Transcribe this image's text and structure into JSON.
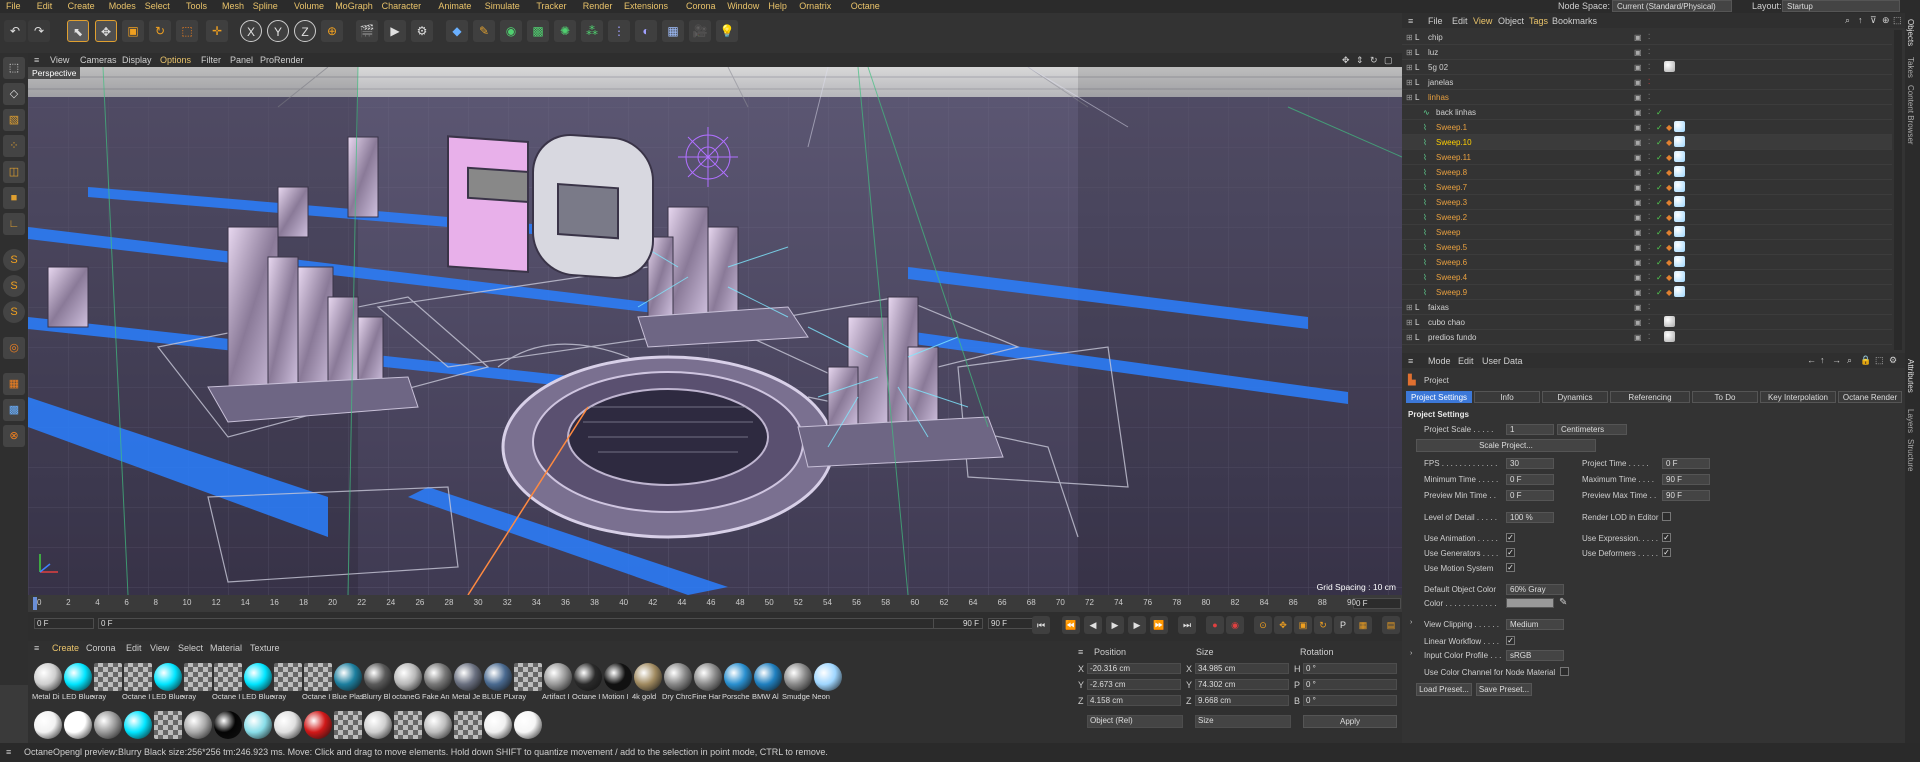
{
  "menu": [
    "File",
    "Edit",
    "Create",
    "Modes",
    "Select",
    "Tools",
    "Mesh",
    "Spline",
    "Volume",
    "MoGraph",
    "Character",
    "Animate",
    "Simulate",
    "Tracker",
    "Render",
    "Extensions",
    "Corona",
    "Window",
    "Help",
    "Ornatrix",
    "Octane"
  ],
  "top_right": {
    "node_space_label": "Node Space:",
    "node_space_value": "Current (Standard/Physical)",
    "layout_label": "Layout:",
    "layout_value": "Startup"
  },
  "viewport": {
    "menu": [
      "View",
      "Cameras",
      "Display",
      "Options",
      "Filter",
      "Panel",
      "ProRender"
    ],
    "label": "Perspective",
    "grid_spacing": "Grid Spacing : 10 cm"
  },
  "timeline": {
    "ticks": [
      "0",
      "2",
      "4",
      "6",
      "8",
      "10",
      "12",
      "14",
      "16",
      "18",
      "20",
      "22",
      "24",
      "26",
      "28",
      "30",
      "32",
      "34",
      "36",
      "38",
      "40",
      "42",
      "44",
      "46",
      "48",
      "50",
      "52",
      "54",
      "56",
      "58",
      "60",
      "62",
      "64",
      "66",
      "68",
      "70",
      "72",
      "74",
      "76",
      "78",
      "80",
      "82",
      "84",
      "86",
      "88",
      "90"
    ],
    "start": "0 F",
    "current": "0 F",
    "end_a": "90 F",
    "end_b": "90 F",
    "frame_right": "0 F"
  },
  "material_panel": {
    "menu": [
      "Create",
      "Corona",
      "Edit",
      "View",
      "Select",
      "Material",
      "Texture"
    ],
    "row1": [
      {
        "name": "Metal Di",
        "color": "#cfcfcf"
      },
      {
        "name": "LED Blue",
        "color": "#00e5ff"
      },
      {
        "name": "xray",
        "color": "checker"
      },
      {
        "name": "Octane I",
        "color": "checker"
      },
      {
        "name": "LED Blue",
        "color": "#00e5ff"
      },
      {
        "name": "xray",
        "color": "checker"
      },
      {
        "name": "Octane I",
        "color": "checker"
      },
      {
        "name": "LED Blue",
        "color": "#00e5ff"
      },
      {
        "name": "xray",
        "color": "checker"
      },
      {
        "name": "Octane I",
        "color": "checker"
      },
      {
        "name": "Blue Plas",
        "color": "#1c7f9f"
      },
      {
        "name": "Blurry Bl",
        "color": "#5a5a5a"
      },
      {
        "name": "octaneG",
        "color": "#b8b8b8"
      },
      {
        "name": "Fake An",
        "color": "#777777"
      },
      {
        "name": "Metal Je",
        "color": "#6a7080"
      },
      {
        "name": "BLUE PL",
        "color": "#4a6a90"
      },
      {
        "name": "xray",
        "color": "checker"
      },
      {
        "name": "Artifact I",
        "color": "#999999"
      },
      {
        "name": "Octane I",
        "color": "#2a2a2a"
      },
      {
        "name": "Motion I",
        "color": "#111111"
      },
      {
        "name": "4k gold",
        "color": "#a08a60"
      },
      {
        "name": "Dry Chrc",
        "color": "#888888"
      },
      {
        "name": "Fine Har",
        "color": "#8a8a8a"
      },
      {
        "name": "Porsche",
        "color": "#2a90d0"
      },
      {
        "name": "BMW Al",
        "color": "#2080c0"
      },
      {
        "name": "Smudge",
        "color": "#8a8a8a"
      },
      {
        "name": "Neon",
        "color": "#9fd6ff"
      }
    ],
    "row2": [
      "#f2f2f2",
      "#ffffff",
      "#9a9a9a",
      "#00e5ff",
      "checker",
      "#aaaaaa",
      "#050505",
      "#88dde8",
      "#e0e0e0",
      "#d01818",
      "checker",
      "#cfcfcf",
      "checker",
      "#bdbdbd",
      "checker",
      "#f0f0f0",
      "#f6f6f6"
    ]
  },
  "coords": {
    "headers": [
      "Position",
      "Size",
      "Rotation"
    ],
    "rows": [
      {
        "axis": "X",
        "pos": "-20.316 cm",
        "size_axis": "X",
        "size": "34.985 cm",
        "rot_axis": "H",
        "rot": "0 °"
      },
      {
        "axis": "Y",
        "pos": "-2.673 cm",
        "size_axis": "Y",
        "size": "74.302 cm",
        "rot_axis": "P",
        "rot": "0 °"
      },
      {
        "axis": "Z",
        "pos": "4.158 cm",
        "size_axis": "Z",
        "size": "9.668 cm",
        "rot_axis": "B",
        "rot": "0 °"
      }
    ],
    "mode": "Object (Rel)",
    "size_mode": "Size",
    "apply": "Apply"
  },
  "status": "OctaneOpengl preview:Blurry Black  size:256*256  tm:246.923 ms.    Move: Click and drag to move elements. Hold down SHIFT to quantize movement / add to the selection in point mode, CTRL to remove.",
  "objects": {
    "menu": [
      "File",
      "Edit",
      "View",
      "Object",
      "Tags",
      "Bookmarks"
    ],
    "items": [
      {
        "name": "chip",
        "indent": 0,
        "style": "normal"
      },
      {
        "name": "luz",
        "indent": 0,
        "style": "normal"
      },
      {
        "name": "5g 02",
        "indent": 0,
        "style": "normal"
      },
      {
        "name": "janelas",
        "indent": 0,
        "style": "normal"
      },
      {
        "name": "linhas",
        "indent": 0,
        "style": "orange"
      },
      {
        "name": "back linhas",
        "indent": 1,
        "style": "normal"
      },
      {
        "name": "Sweep.1",
        "indent": 1,
        "style": "orange"
      },
      {
        "name": "Sweep.10",
        "indent": 1,
        "style": "yellow"
      },
      {
        "name": "Sweep.11",
        "indent": 1,
        "style": "orange"
      },
      {
        "name": "Sweep.8",
        "indent": 1,
        "style": "orange"
      },
      {
        "name": "Sweep.7",
        "indent": 1,
        "style": "orange"
      },
      {
        "name": "Sweep.3",
        "indent": 1,
        "style": "orange"
      },
      {
        "name": "Sweep.2",
        "indent": 1,
        "style": "orange"
      },
      {
        "name": "Sweep",
        "indent": 1,
        "style": "orange"
      },
      {
        "name": "Sweep.5",
        "indent": 1,
        "style": "orange"
      },
      {
        "name": "Sweep.6",
        "indent": 1,
        "style": "orange"
      },
      {
        "name": "Sweep.4",
        "indent": 1,
        "style": "orange"
      },
      {
        "name": "Sweep.9",
        "indent": 1,
        "style": "orange"
      },
      {
        "name": "faixas",
        "indent": 0,
        "style": "normal"
      },
      {
        "name": "cubo chao",
        "indent": 0,
        "style": "normal"
      },
      {
        "name": "predios fundo",
        "indent": 0,
        "style": "normal"
      }
    ]
  },
  "attributes": {
    "menu": [
      "Mode",
      "Edit",
      "User Data"
    ],
    "object": "Project",
    "tabs": [
      "Project Settings",
      "Info",
      "Dynamics",
      "Referencing",
      "To Do",
      "Key Interpolation",
      "Octane Render"
    ],
    "section": "Project Settings",
    "project_scale_label": "Project Scale . . . . .",
    "project_scale_value": "1",
    "project_scale_unit": "Centimeters",
    "scale_project": "Scale Project...",
    "fps_label": "FPS . . . . . . . . . . . . .",
    "fps": "30",
    "project_time_label": "Project Time  . . . . .",
    "project_time": "0 F",
    "min_time_label": "Minimum Time . . . . .",
    "min_time": "0 F",
    "max_time_label": "Maximum Time . . . .",
    "max_time": "90 F",
    "prev_min_label": "Preview Min Time . .",
    "prev_min": "0 F",
    "prev_max_label": "Preview Max Time . .",
    "prev_max": "90 F",
    "lod_label": "Level of Detail . . . . .",
    "lod": "100 %",
    "render_lod_label": "Render LOD in Editor",
    "use_animation": "Use Animation . . . . .",
    "use_expression": "Use Expression. . . . .",
    "use_generators": "Use Generators . . . .",
    "use_deformers": "Use Deformers . . . . .",
    "use_motion": "Use Motion System",
    "default_color_label": "Default Object Color",
    "default_color": "60% Gray",
    "color_label": "Color . . . . . . . . . . . .",
    "view_clipping_label": "View Clipping . . . . . .",
    "view_clipping": "Medium",
    "linear_label": "Linear Workflow . . . .",
    "input_profile_label": "Input Color Profile . . .",
    "input_profile": "sRGB",
    "use_color_channel": "Use Color Channel for Node Material",
    "load_preset": "Load Preset...",
    "save_preset": "Save Preset..."
  },
  "right_strip": [
    "Objects",
    "Takes",
    "Content Browser",
    "Attributes",
    "Layers",
    "Structure"
  ]
}
